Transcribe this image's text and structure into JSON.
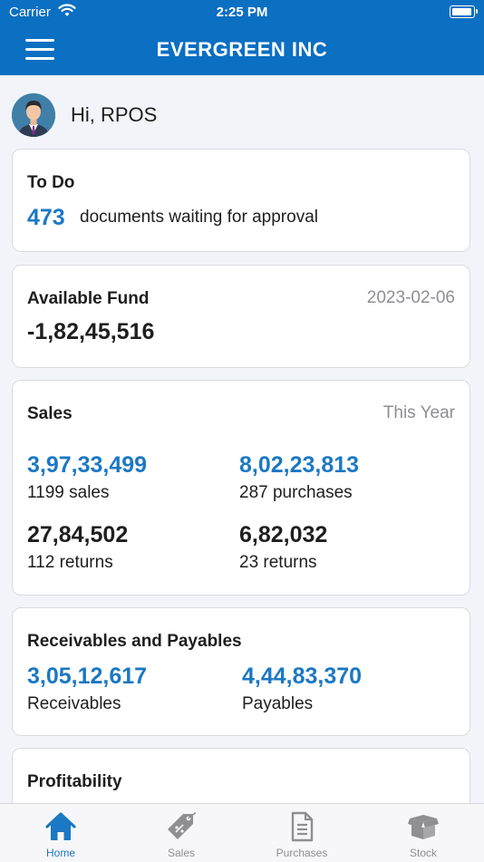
{
  "status_bar": {
    "carrier": "Carrier",
    "time": "2:25 PM"
  },
  "header": {
    "title": "EVERGREEN INC"
  },
  "greeting": {
    "text": "Hi, RPOS"
  },
  "todo": {
    "title": "To Do",
    "count": "473",
    "description": "documents waiting for approval"
  },
  "fund": {
    "title": "Available Fund",
    "date": "2023-02-06",
    "amount": "-1,82,45,516"
  },
  "sales": {
    "title": "Sales",
    "period": "This Year",
    "sales_amount": "3,97,33,499",
    "sales_label": "1199 sales",
    "purchases_amount": "8,02,23,813",
    "purchases_label": "287 purchases",
    "sales_returns_amount": "27,84,502",
    "sales_returns_label": "112 returns",
    "purchase_returns_amount": "6,82,032",
    "purchase_returns_label": "23 returns"
  },
  "receivables": {
    "title": "Receivables and Payables",
    "receivables_amount": "3,05,12,617",
    "receivables_label": "Receivables",
    "payables_amount": "4,44,83,370",
    "payables_label": "Payables"
  },
  "profitability": {
    "title": "Profitability"
  },
  "tabs": [
    {
      "label": "Home",
      "icon": "home-icon",
      "active": true
    },
    {
      "label": "Sales",
      "icon": "price-tag-icon",
      "active": false
    },
    {
      "label": "Purchases",
      "icon": "document-icon",
      "active": false
    },
    {
      "label": "Stock",
      "icon": "box-icon",
      "active": false
    }
  ],
  "colors": {
    "primary": "#0b6fc2",
    "accent_blue": "#1b78c4",
    "background": "#f2f4f9",
    "muted": "#8e8e93"
  }
}
